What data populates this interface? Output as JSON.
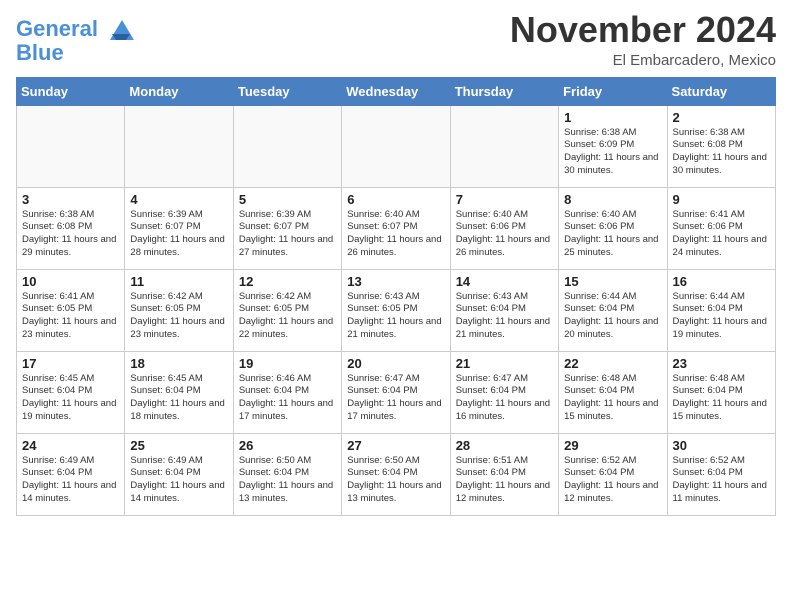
{
  "header": {
    "logo_general": "General",
    "logo_blue": "Blue",
    "month_title": "November 2024",
    "location": "El Embarcadero, Mexico"
  },
  "days_of_week": [
    "Sunday",
    "Monday",
    "Tuesday",
    "Wednesday",
    "Thursday",
    "Friday",
    "Saturday"
  ],
  "weeks": [
    [
      {
        "day": "",
        "info": ""
      },
      {
        "day": "",
        "info": ""
      },
      {
        "day": "",
        "info": ""
      },
      {
        "day": "",
        "info": ""
      },
      {
        "day": "",
        "info": ""
      },
      {
        "day": "1",
        "info": "Sunrise: 6:38 AM\nSunset: 6:09 PM\nDaylight: 11 hours and 30 minutes."
      },
      {
        "day": "2",
        "info": "Sunrise: 6:38 AM\nSunset: 6:08 PM\nDaylight: 11 hours and 30 minutes."
      }
    ],
    [
      {
        "day": "3",
        "info": "Sunrise: 6:38 AM\nSunset: 6:08 PM\nDaylight: 11 hours and 29 minutes."
      },
      {
        "day": "4",
        "info": "Sunrise: 6:39 AM\nSunset: 6:07 PM\nDaylight: 11 hours and 28 minutes."
      },
      {
        "day": "5",
        "info": "Sunrise: 6:39 AM\nSunset: 6:07 PM\nDaylight: 11 hours and 27 minutes."
      },
      {
        "day": "6",
        "info": "Sunrise: 6:40 AM\nSunset: 6:07 PM\nDaylight: 11 hours and 26 minutes."
      },
      {
        "day": "7",
        "info": "Sunrise: 6:40 AM\nSunset: 6:06 PM\nDaylight: 11 hours and 26 minutes."
      },
      {
        "day": "8",
        "info": "Sunrise: 6:40 AM\nSunset: 6:06 PM\nDaylight: 11 hours and 25 minutes."
      },
      {
        "day": "9",
        "info": "Sunrise: 6:41 AM\nSunset: 6:06 PM\nDaylight: 11 hours and 24 minutes."
      }
    ],
    [
      {
        "day": "10",
        "info": "Sunrise: 6:41 AM\nSunset: 6:05 PM\nDaylight: 11 hours and 23 minutes."
      },
      {
        "day": "11",
        "info": "Sunrise: 6:42 AM\nSunset: 6:05 PM\nDaylight: 11 hours and 23 minutes."
      },
      {
        "day": "12",
        "info": "Sunrise: 6:42 AM\nSunset: 6:05 PM\nDaylight: 11 hours and 22 minutes."
      },
      {
        "day": "13",
        "info": "Sunrise: 6:43 AM\nSunset: 6:05 PM\nDaylight: 11 hours and 21 minutes."
      },
      {
        "day": "14",
        "info": "Sunrise: 6:43 AM\nSunset: 6:04 PM\nDaylight: 11 hours and 21 minutes."
      },
      {
        "day": "15",
        "info": "Sunrise: 6:44 AM\nSunset: 6:04 PM\nDaylight: 11 hours and 20 minutes."
      },
      {
        "day": "16",
        "info": "Sunrise: 6:44 AM\nSunset: 6:04 PM\nDaylight: 11 hours and 19 minutes."
      }
    ],
    [
      {
        "day": "17",
        "info": "Sunrise: 6:45 AM\nSunset: 6:04 PM\nDaylight: 11 hours and 19 minutes."
      },
      {
        "day": "18",
        "info": "Sunrise: 6:45 AM\nSunset: 6:04 PM\nDaylight: 11 hours and 18 minutes."
      },
      {
        "day": "19",
        "info": "Sunrise: 6:46 AM\nSunset: 6:04 PM\nDaylight: 11 hours and 17 minutes."
      },
      {
        "day": "20",
        "info": "Sunrise: 6:47 AM\nSunset: 6:04 PM\nDaylight: 11 hours and 17 minutes."
      },
      {
        "day": "21",
        "info": "Sunrise: 6:47 AM\nSunset: 6:04 PM\nDaylight: 11 hours and 16 minutes."
      },
      {
        "day": "22",
        "info": "Sunrise: 6:48 AM\nSunset: 6:04 PM\nDaylight: 11 hours and 15 minutes."
      },
      {
        "day": "23",
        "info": "Sunrise: 6:48 AM\nSunset: 6:04 PM\nDaylight: 11 hours and 15 minutes."
      }
    ],
    [
      {
        "day": "24",
        "info": "Sunrise: 6:49 AM\nSunset: 6:04 PM\nDaylight: 11 hours and 14 minutes."
      },
      {
        "day": "25",
        "info": "Sunrise: 6:49 AM\nSunset: 6:04 PM\nDaylight: 11 hours and 14 minutes."
      },
      {
        "day": "26",
        "info": "Sunrise: 6:50 AM\nSunset: 6:04 PM\nDaylight: 11 hours and 13 minutes."
      },
      {
        "day": "27",
        "info": "Sunrise: 6:50 AM\nSunset: 6:04 PM\nDaylight: 11 hours and 13 minutes."
      },
      {
        "day": "28",
        "info": "Sunrise: 6:51 AM\nSunset: 6:04 PM\nDaylight: 11 hours and 12 minutes."
      },
      {
        "day": "29",
        "info": "Sunrise: 6:52 AM\nSunset: 6:04 PM\nDaylight: 11 hours and 12 minutes."
      },
      {
        "day": "30",
        "info": "Sunrise: 6:52 AM\nSunset: 6:04 PM\nDaylight: 11 hours and 11 minutes."
      }
    ]
  ]
}
